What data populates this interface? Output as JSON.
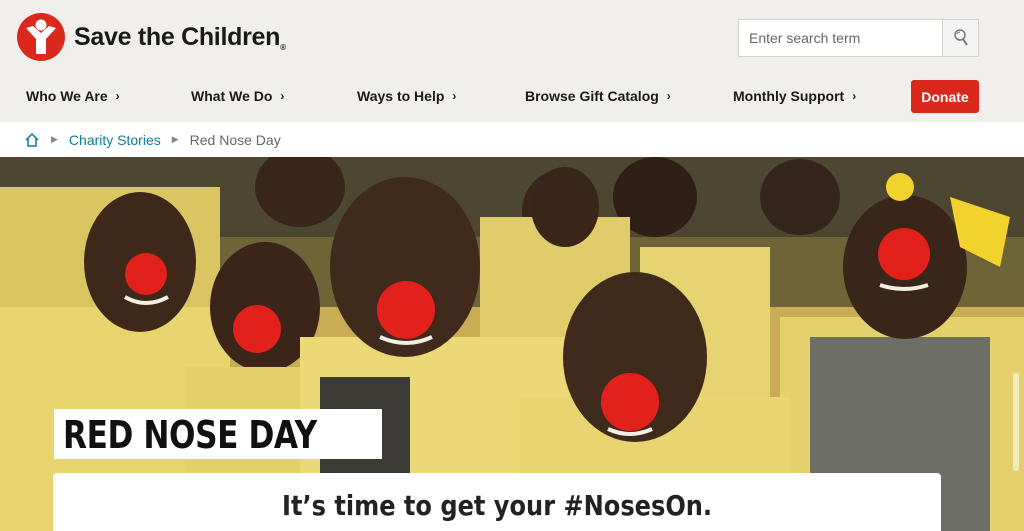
{
  "brand": {
    "name": "Save the Children",
    "registered": "®",
    "logo_icon": "save-the-children-logo"
  },
  "search": {
    "placeholder": "Enter search term",
    "value": "",
    "icon": "search-icon"
  },
  "nav": {
    "items": [
      {
        "label": "Who We Are",
        "icon": "chevron-right-icon"
      },
      {
        "label": "What We Do",
        "icon": "chevron-right-icon"
      },
      {
        "label": "Ways to Help",
        "icon": "chevron-right-icon"
      },
      {
        "label": "Browse Gift Catalog",
        "icon": "chevron-right-icon"
      },
      {
        "label": "Monthly Support",
        "icon": "chevron-right-icon"
      }
    ],
    "donate_label": "Donate"
  },
  "breadcrumb": {
    "home_icon": "home-icon",
    "items": [
      {
        "label": "Charity Stories",
        "link": true
      },
      {
        "label": "Red Nose Day",
        "link": false
      }
    ]
  },
  "hero": {
    "title": "RED NOSE DAY",
    "subtitle": "It’s time to get your #NosesOn."
  },
  "colors": {
    "header_bg": "#f1efeb",
    "brand_red": "#da291c",
    "link_teal": "#0c7c97",
    "text_dark": "#1a1a1a"
  }
}
